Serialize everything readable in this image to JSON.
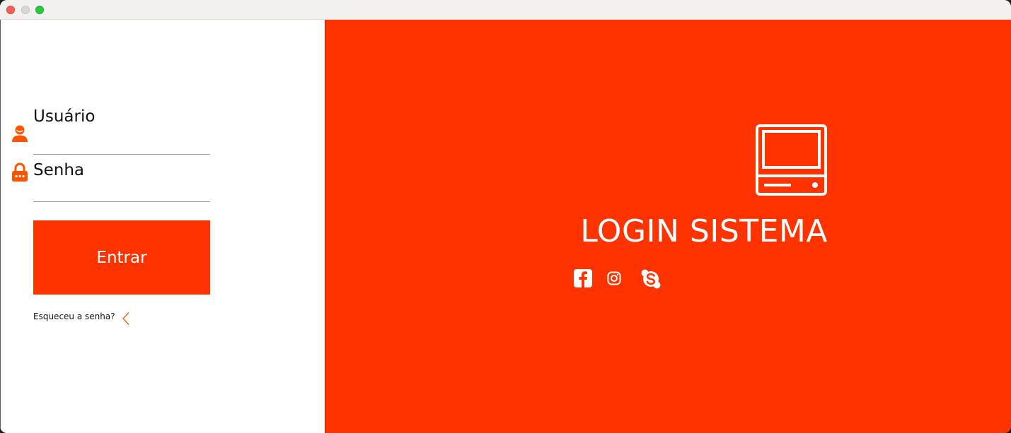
{
  "window": {
    "controls": [
      "close",
      "minimize",
      "maximize"
    ]
  },
  "login_form": {
    "username_label": "Usuário",
    "username_value": "",
    "password_label": "Senha",
    "password_value": "",
    "submit_label": "Entrar",
    "forgot_password_link": "Esqueceu a senha?"
  },
  "brand": {
    "title": "LOGIN SISTEMA",
    "social_icons": [
      "facebook-icon",
      "instagram-icon",
      "skype-icon"
    ]
  },
  "icons": {
    "username": "user-icon",
    "password": "lock-icon",
    "forgot": "chevron-left-icon",
    "brand": "monitor-icon"
  },
  "colors": {
    "accent": "#ff3300",
    "panel_background": "#ffffff",
    "brand_text": "#ffffff"
  }
}
